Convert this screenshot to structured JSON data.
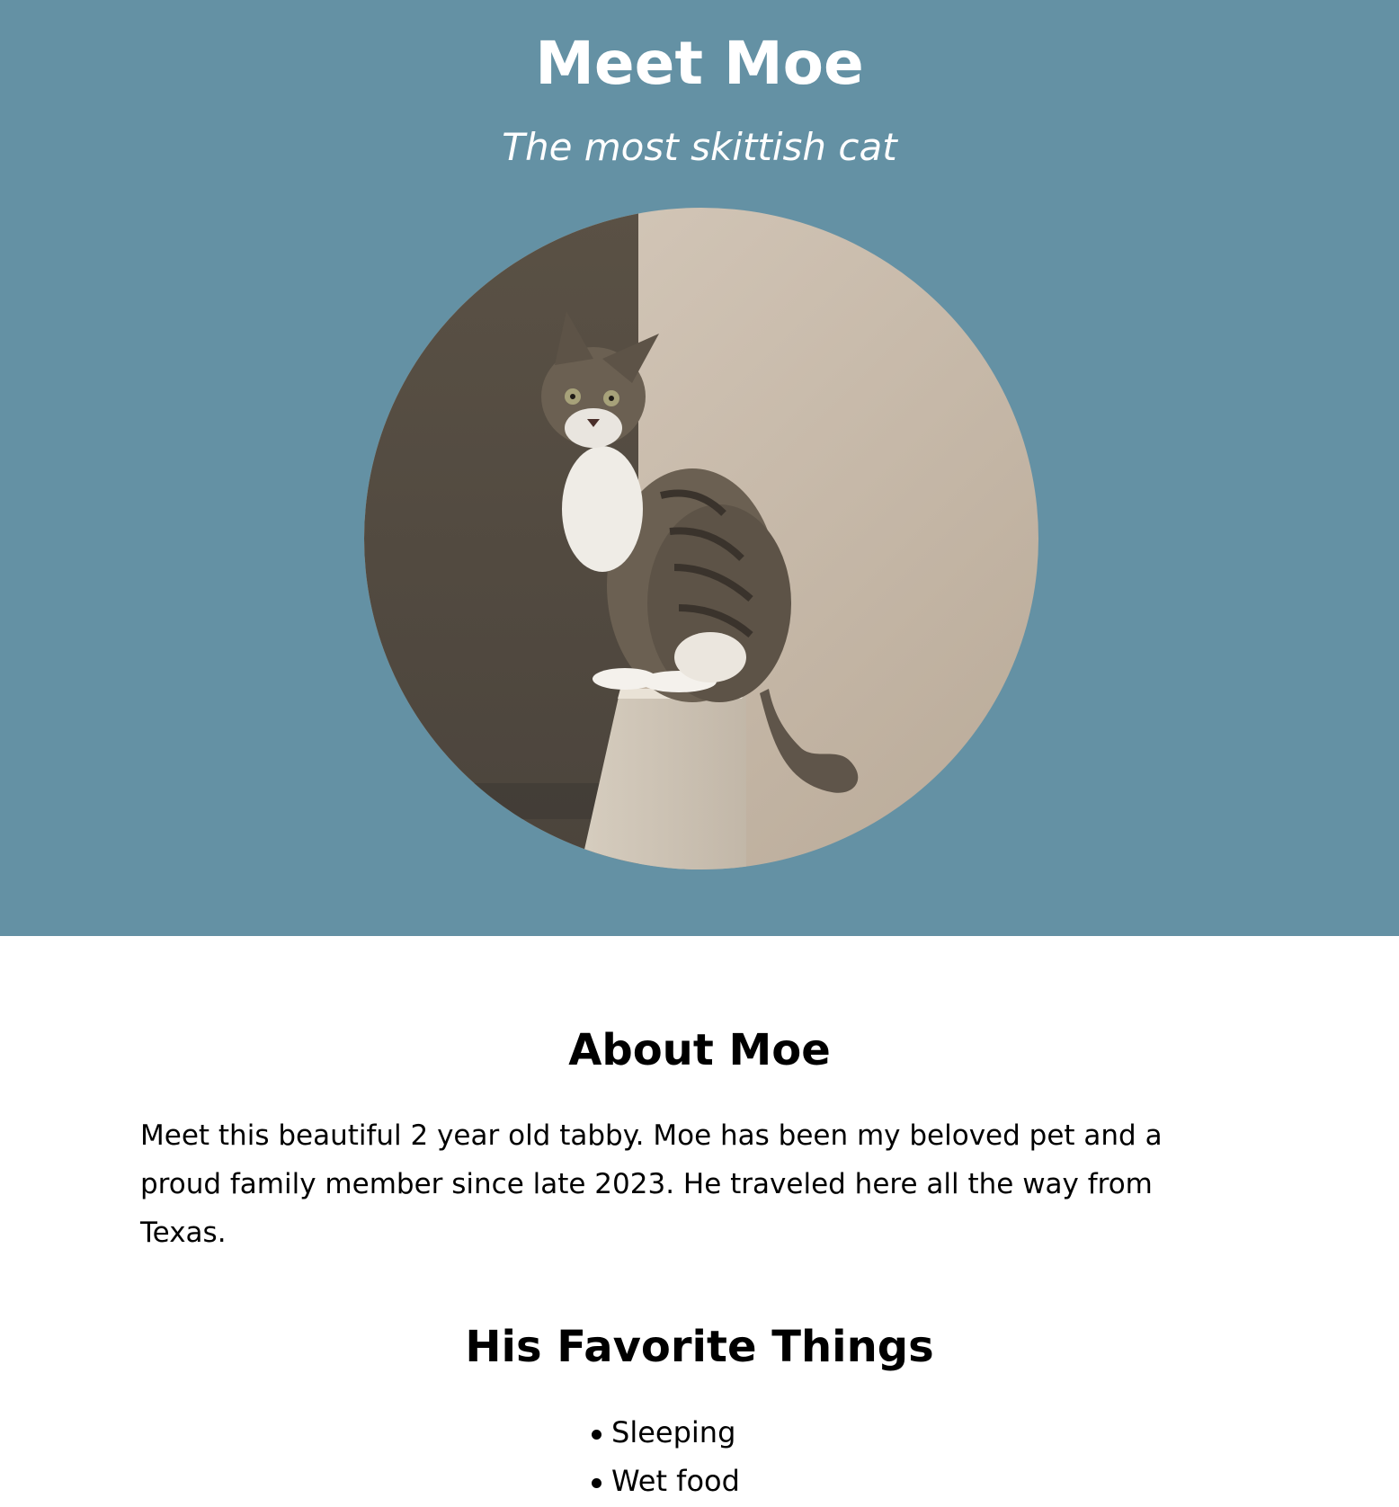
{
  "hero": {
    "title": "Meet Moe",
    "subtitle": "The most skittish cat",
    "background_color": "#6491a4",
    "text_color": "#ffffff"
  },
  "photo": {
    "subject": "Moe the tabby cat sitting on a white post in a corner"
  },
  "about": {
    "heading": "About Moe",
    "text": "Meet this beautiful 2 year old tabby. Moe has been my beloved pet and a proud family member since late 2023. He traveled here all the way from Texas."
  },
  "favorites": {
    "heading": "His Favorite Things",
    "items": [
      "Sleeping",
      "Wet food"
    ]
  }
}
